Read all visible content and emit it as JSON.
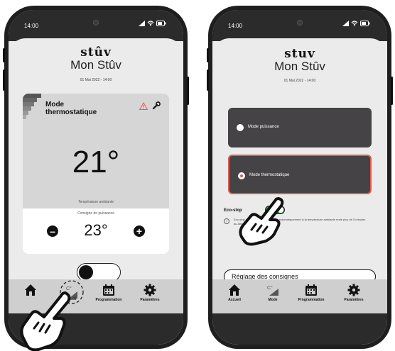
{
  "phones": [
    {
      "status": {
        "time": "14:00"
      },
      "logo": "stûv",
      "brand": "Mon Stûv",
      "date": "01 Mai 2022  -  14:00",
      "card": {
        "mode_title": "Mode thermostatique",
        "temperature": "21°",
        "caption_ambient": "Température ambiante",
        "caption_setpoint": "Consigne de puissance",
        "setpoint": "23°",
        "minus_icon": "minus-icon",
        "plus_icon": "plus-icon"
      },
      "toggle": {
        "state": "off"
      },
      "nav": {
        "home": "",
        "mode": "Mode",
        "programmation": "Programmation",
        "parametres": "Paramètres"
      }
    },
    {
      "status": {
        "time": "14:00"
      },
      "logo": "stuv",
      "brand": "Mon Stûv",
      "date": "01 Mai 2022  -  14:00",
      "modes": [
        {
          "label": "Mode puissance",
          "selected": false
        },
        {
          "label": "Mode thermostatique",
          "selected": true
        }
      ],
      "eco": {
        "label": "Eco-stop",
        "state": "on",
        "text": "Eco-stop est actif, l'appareil s'éteint automatiquement si la température ambiante reste plus de 5 minutes au-dessus."
      },
      "reglage": "Réglage des consignes",
      "nav": {
        "accueil": "Accueil",
        "mode": "Mode",
        "programmation": "Programmation",
        "parametres": "Paramètres"
      }
    }
  ],
  "colors": {
    "accent": "#e35a50",
    "dark": "#454345",
    "green": "#3aa14a"
  }
}
